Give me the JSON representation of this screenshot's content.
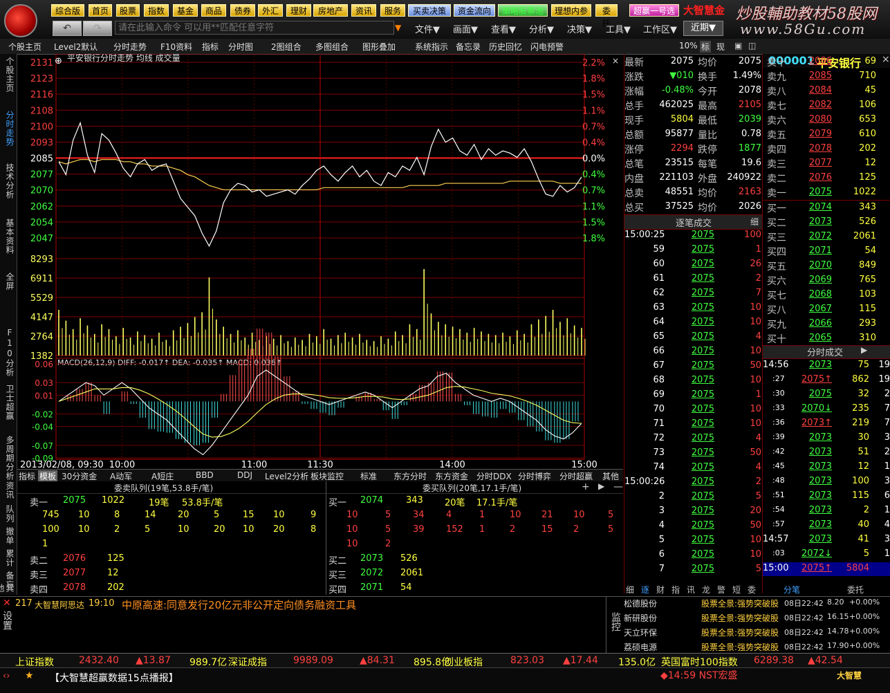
{
  "topbar": {
    "buttons": [
      "综合版",
      "首页",
      "股票",
      "指数",
      "基金",
      "商品",
      "债券",
      "外汇",
      "理财",
      "房地产",
      "资讯",
      "服务",
      "买卖决策",
      "资金流向",
      "策略股票池",
      "理想内参",
      "委托",
      "超赢一号选"
    ],
    "brand": "大智慧金",
    "watermark_top": "炒股輔助教材58股网",
    "watermark_url": "www.58Gu.com",
    "command_placeholder": "请在此输入命令  可以用**匹配任意字符",
    "menus": [
      "文件▼",
      "画面▼",
      "查看▼",
      "分析▼",
      "决策▼",
      "工具▼",
      "工作区▼"
    ],
    "recent": "近期▼"
  },
  "toolbar2": [
    "个股主页",
    "Level2默认",
    "分时走势",
    "F10资料",
    "指标",
    "分时图",
    "2图组合",
    "多图组合",
    "图形叠加",
    "系统指示",
    "备忘录",
    "历史回忆",
    "闪电预警",
    "10%",
    "标",
    "现"
  ],
  "lefttabs": [
    "个股主页",
    "分时走势",
    "技术分析",
    "基本资料",
    "全屏",
    "F10分析",
    "卫士超赢",
    "多周期分析",
    "资讯",
    "队列",
    "撤单",
    "累计",
    "备忘",
    "其他"
  ],
  "chart_data": {
    "type": "line",
    "title": "平安银行分时走势 均线 成交量",
    "price_ticks_left": [
      "2131",
      "2123",
      "2116",
      "2108",
      "2100",
      "2093",
      "2085",
      "2077",
      "2070",
      "2062",
      "2054",
      "2047"
    ],
    "pct_ticks_right": [
      "2.2%",
      "1.8%",
      "1.5%",
      "1.1%",
      "0.7%",
      "0.4%",
      "0.0%",
      "0.4%",
      "0.7%",
      "1.1%",
      "1.5%",
      "1.8%"
    ],
    "volume_ticks": [
      "8293",
      "6911",
      "5529",
      "4147",
      "2764",
      "1382"
    ],
    "macd_label": "MACD(26,12,9) DIFF: -0.017↑ DEA: -0.035↑ MACD: 0.036↑",
    "macd_ticks": [
      "0.06",
      "0.03",
      "0.01",
      "-0.02",
      "-0.04",
      "-0.07",
      "-0.09"
    ],
    "time_labels": [
      "2013/02/08, 09:30",
      "10:00",
      "11:00",
      "11:30",
      "14:00",
      "15:00"
    ],
    "prev_close": 2085,
    "price_min": 2044,
    "price_max": 2131,
    "price": [
      2085,
      2079,
      2095,
      2103,
      2088,
      2080,
      2098,
      2095,
      2089,
      2082,
      2078,
      2084,
      2086,
      2081,
      2083,
      2084,
      2076,
      2068,
      2064,
      2060,
      2052,
      2046,
      2053,
      2066,
      2072,
      2075,
      2074,
      2071,
      2072,
      2069,
      2070,
      2071,
      2072,
      2070,
      2074,
      2077,
      2081,
      2083,
      2079,
      2076,
      2080,
      2083,
      2078,
      2081,
      2076,
      2074,
      2080,
      2078,
      2083,
      2081,
      2087,
      2079,
      2092,
      2100,
      2094,
      2096,
      2090,
      2088,
      2093,
      2086,
      2091,
      2088,
      2090,
      2089,
      2087,
      2091,
      2085,
      2077,
      2070,
      2069,
      2074,
      2071,
      2073,
      2078
    ],
    "avg": [
      2085,
      2084,
      2085,
      2086,
      2086,
      2085,
      2086,
      2086,
      2086,
      2085,
      2085,
      2084,
      2084,
      2083,
      2083,
      2083,
      2082,
      2081,
      2079,
      2078,
      2076,
      2074,
      2073,
      2072,
      2072,
      2072,
      2072,
      2072,
      2072,
      2072,
      2072,
      2072,
      2072,
      2072,
      2072,
      2072,
      2072,
      2073,
      2073,
      2073,
      2073,
      2073,
      2073,
      2073,
      2073,
      2073,
      2073,
      2073,
      2073,
      2074,
      2074,
      2074,
      2074,
      2074,
      2075,
      2075,
      2075,
      2075,
      2075,
      2075,
      2075,
      2075,
      2075,
      2076,
      2076,
      2076,
      2076,
      2076,
      2076,
      2076,
      2075,
      2075,
      2075,
      2075
    ],
    "volume": [
      3800,
      2900,
      2200,
      3100,
      2500,
      1800,
      2600,
      2200,
      1600,
      2300,
      1500,
      2000,
      1700,
      1400,
      1900,
      1300,
      2100,
      2400,
      2700,
      3200,
      3600,
      6500,
      3000,
      2400,
      1800,
      2100,
      1500,
      1900,
      1300,
      1600,
      1400,
      1700,
      1200,
      1500,
      1300,
      1800,
      1600,
      2200,
      1400,
      1700,
      1900,
      1500,
      1800,
      1300,
      1200,
      1600,
      1400,
      2000,
      1700,
      2600,
      2200,
      7200,
      3500,
      2800,
      2600,
      2400,
      2200,
      1900,
      2300,
      2000,
      1800,
      1700,
      1900,
      1600,
      2100,
      1800,
      2600,
      3000,
      3300,
      3800,
      2800,
      3100,
      2500,
      2300
    ],
    "macd_diff": [
      0.0,
      0.01,
      0.02,
      0.03,
      0.025,
      0.01,
      0.02,
      0.03,
      0.02,
      0.005,
      -0.01,
      -0.02,
      -0.03,
      -0.045,
      -0.06,
      -0.075,
      -0.085,
      -0.07,
      -0.05,
      -0.03,
      -0.01,
      0.01,
      0.04,
      0.05,
      0.04,
      0.03,
      0.02,
      0.01,
      0.005,
      0.0,
      -0.005,
      0.0,
      0.005,
      0.01,
      0.015,
      0.01,
      0.0,
      -0.01,
      0.0,
      0.01,
      0.02,
      0.025,
      0.04,
      0.045,
      0.03,
      0.02,
      0.01,
      0.005,
      0.0,
      0.005,
      0.0,
      -0.01,
      -0.02,
      -0.03,
      -0.045,
      -0.055,
      -0.06,
      -0.05,
      -0.035
    ],
    "macd_dea": [
      0.0,
      0.005,
      0.01,
      0.015,
      0.02,
      0.02,
      0.02,
      0.022,
      0.022,
      0.018,
      0.012,
      0.004,
      -0.005,
      -0.015,
      -0.027,
      -0.04,
      -0.052,
      -0.057,
      -0.056,
      -0.051,
      -0.043,
      -0.032,
      -0.018,
      -0.005,
      0.004,
      0.01,
      0.012,
      0.012,
      0.011,
      0.009,
      0.006,
      0.005,
      0.005,
      0.006,
      0.008,
      0.008,
      0.007,
      0.004,
      0.003,
      0.004,
      0.007,
      0.01,
      0.016,
      0.022,
      0.024,
      0.023,
      0.02,
      0.017,
      0.013,
      0.011,
      0.009,
      0.005,
      0.0,
      -0.006,
      -0.014,
      -0.022,
      -0.03,
      -0.034,
      -0.035
    ]
  },
  "quote": {
    "rows": [
      [
        "最新",
        "2075",
        "均价",
        "2075"
      ],
      [
        "涨跌",
        "▼010",
        "换手",
        "1.49%"
      ],
      [
        "涨幅",
        "-0.48%",
        "今开",
        "2078"
      ],
      [
        "总手",
        "462025",
        "最高",
        "2105"
      ],
      [
        "现手",
        "5804",
        "最低",
        "2039"
      ],
      [
        "总额",
        "95877",
        "量比",
        "0.78"
      ],
      [
        "涨停",
        "2294",
        "跌停",
        "1877"
      ],
      [
        "总笔",
        "23515",
        "每笔",
        "19.6"
      ],
      [
        "内盘",
        "221103",
        "外盘",
        "240922"
      ],
      [
        "总卖",
        "48551",
        "均价",
        "2163"
      ],
      [
        "总买",
        "37525",
        "均价",
        "2026"
      ]
    ],
    "ticks_header": "逐笔成交",
    "ticks_detail": "细",
    "ticks": [
      [
        "15:00:25",
        "2075",
        "100"
      ],
      [
        "59",
        "2075",
        "1"
      ],
      [
        "60",
        "2075",
        "26"
      ],
      [
        "61",
        "2075",
        "2"
      ],
      [
        "62",
        "2075",
        "7"
      ],
      [
        "63",
        "2075",
        "10"
      ],
      [
        "64",
        "2075",
        "10"
      ],
      [
        "65",
        "2075",
        "4"
      ],
      [
        "66",
        "2075",
        "10"
      ],
      [
        "67",
        "2075",
        "50"
      ],
      [
        "68",
        "2075",
        "10"
      ],
      [
        "69",
        "2075",
        "1"
      ],
      [
        "70",
        "2075",
        "10"
      ],
      [
        "71",
        "2075",
        "10"
      ],
      [
        "72",
        "2075",
        "4"
      ],
      [
        "73",
        "2075",
        "50"
      ],
      [
        "74",
        "2075",
        "4"
      ],
      [
        "15:00:26",
        "2075",
        "2"
      ],
      [
        "2",
        "2075",
        "5"
      ],
      [
        "3",
        "2075",
        "20"
      ],
      [
        "4",
        "2075",
        "50"
      ],
      [
        "5",
        "2075",
        "10"
      ],
      [
        "6",
        "2075",
        "10"
      ],
      [
        "7",
        "2075",
        "5"
      ]
    ],
    "footer_tabs": [
      "细",
      "逐",
      "财",
      "指",
      "讯",
      "龙",
      "警",
      "短",
      "委"
    ]
  },
  "book": {
    "code": "000001",
    "name": "平安银行",
    "asks": [
      [
        "卖十",
        "2086",
        "69"
      ],
      [
        "卖九",
        "2085",
        "710"
      ],
      [
        "卖八",
        "2084",
        "45"
      ],
      [
        "卖七",
        "2082",
        "106"
      ],
      [
        "卖六",
        "2080",
        "653"
      ],
      [
        "卖五",
        "2079",
        "610"
      ],
      [
        "卖四",
        "2078",
        "202"
      ],
      [
        "卖三",
        "2077",
        "12"
      ],
      [
        "卖二",
        "2076",
        "125"
      ],
      [
        "卖一",
        "2075",
        "1022"
      ]
    ],
    "bids": [
      [
        "买一",
        "2074",
        "343"
      ],
      [
        "买二",
        "2073",
        "526"
      ],
      [
        "买三",
        "2072",
        "2061"
      ],
      [
        "买四",
        "2071",
        "54"
      ],
      [
        "买五",
        "2070",
        "849"
      ],
      [
        "买六",
        "2069",
        "765"
      ],
      [
        "买七",
        "2068",
        "103"
      ],
      [
        "买八",
        "2067",
        "115"
      ],
      [
        "买九",
        "2066",
        "293"
      ],
      [
        "买十",
        "2065",
        "310"
      ]
    ],
    "trades_header": "分时成交",
    "trades": [
      [
        "14:56",
        "2073",
        "75",
        "19"
      ],
      [
        ":27",
        "2075↑",
        "862",
        "19"
      ],
      [
        ":30",
        "2075",
        "32",
        "2"
      ],
      [
        ":33",
        "2070↓",
        "235",
        "7"
      ],
      [
        ":36",
        "2073↑",
        "219",
        "7"
      ],
      [
        ":39",
        "2073",
        "30",
        "3"
      ],
      [
        ":42",
        "2073",
        "51",
        "2"
      ],
      [
        ":45",
        "2073",
        "12",
        "1"
      ],
      [
        ":48",
        "2073",
        "100",
        "3"
      ],
      [
        ":51",
        "2073",
        "115",
        "6"
      ],
      [
        ":54",
        "2073",
        "2",
        "1"
      ],
      [
        ":57",
        "2073",
        "40",
        "4"
      ],
      [
        "14:57",
        "2073",
        "41",
        "3"
      ],
      [
        ":03",
        "2072↓",
        "5",
        "1"
      ],
      [
        "15:00",
        "2075↑",
        "5804",
        ""
      ]
    ],
    "footer_tabs": [
      "分笔",
      "委托"
    ]
  },
  "bottom": {
    "tabs": [
      "指标",
      "模板",
      "30分资金",
      "A动军",
      "A短庄",
      "BBD",
      "DDJ",
      "Level2分析",
      "板块监控",
      "标准",
      "东方分时",
      "东方资金",
      "分时DDX",
      "分时博弈",
      "分时超赢",
      "其他"
    ],
    "sell_header": "委卖队列(19笔,53.8手/笔)",
    "buy_header": "委买队列(20笔,17.1手/笔)",
    "sell1": {
      "label": "卖一",
      "price": "2075",
      "vol": "1022",
      "count": "19笔",
      "avg": "53.8手/笔"
    },
    "sell_rows": [
      [
        "745",
        "10",
        "8",
        "14",
        "20",
        "5",
        "15",
        "10",
        "9"
      ],
      [
        "100",
        "10",
        "2",
        "5",
        "10",
        "20",
        "10",
        "20",
        "8"
      ],
      [
        "1"
      ]
    ],
    "sell_levels": [
      [
        "卖二",
        "2076",
        "125"
      ],
      [
        "卖三",
        "2077",
        "12"
      ],
      [
        "卖四",
        "2078",
        "202"
      ]
    ],
    "buy1": {
      "label": "买一",
      "price": "2074",
      "vol": "343",
      "count": "20笔",
      "avg": "17.1手/笔"
    },
    "buy_rows": [
      [
        "10",
        "5",
        "34",
        "4",
        "1",
        "10",
        "21",
        "10",
        "5"
      ],
      [
        "10",
        "5",
        "39",
        "152",
        "1",
        "2",
        "15",
        "2",
        "5"
      ],
      [
        "10",
        "2"
      ]
    ],
    "buy_levels": [
      [
        "买二",
        "2073",
        "526"
      ],
      [
        "买三",
        "2072",
        "2061"
      ],
      [
        "买四",
        "2071",
        "54"
      ]
    ]
  },
  "news": {
    "headline_id": "217",
    "source": "大智慧阿思达",
    "time": "19:10",
    "text": "中原高速:同意发行20亿元非公开定向债务融资工具",
    "side_label": "设置",
    "monitor_label": "监控",
    "alerts": [
      [
        "松德股份",
        "股票全景:强势突破股",
        "08日22:42",
        "8.20",
        "+0.00%"
      ],
      [
        "新研股份",
        "股票全景:强势突破股",
        "08日22:42",
        "16.15",
        "+0.00%"
      ],
      [
        "天立环保",
        "股票全景:强势突破股",
        "08日22:42",
        "14.78",
        "+0.00%"
      ],
      [
        "荔硕电源",
        "股票全景:强势突破股",
        "08日22:42",
        "17.90",
        "+0.00%"
      ]
    ]
  },
  "status": {
    "items": [
      {
        "name": "上证指数",
        "value": "2432.40",
        "chg": "▲13.87",
        "amt": "989.7亿"
      },
      {
        "name": "深证成指",
        "value": "9989.09",
        "chg": "▲84.31",
        "amt": "895.8亿"
      },
      {
        "name": "创业板指",
        "value": "823.03",
        "chg": "▲17.44",
        "amt": "135.0亿"
      },
      {
        "name": "英国富时100指数",
        "value": "6289.38",
        "chg": "▲42.54",
        "amt": ""
      }
    ],
    "ticker": "【大智慧超赢数据15点播报】",
    "alert": "◆14:59 NST宏盛",
    "brand_logo": "大智慧"
  }
}
